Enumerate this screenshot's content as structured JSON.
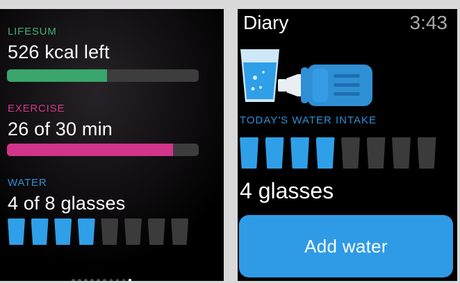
{
  "colors": {
    "lifesum_green": "#3aa56c",
    "exercise_pink": "#d2348a",
    "water_blue": "#2f9fe8",
    "track_gray": "#3d3d3d",
    "button_blue": "#2f9be6"
  },
  "summary": {
    "lifesum": {
      "label": "LIFESUM",
      "value": "526 kcal left",
      "progress": 0.52
    },
    "exercise": {
      "label": "EXERCISE",
      "value": "26 of 30 min",
      "progress": 0.867
    },
    "water": {
      "label": "WATER",
      "value": "4 of 8 glasses",
      "filled": 4,
      "total": 8
    },
    "pager": {
      "count": 10,
      "active": 9
    }
  },
  "diary": {
    "title": "Diary",
    "time": "3:43",
    "icons": [
      "water-glass-icon",
      "water-bottle-icon"
    ],
    "intake_label": "TODAY'S WATER INTAKE",
    "filled": 4,
    "total": 8,
    "count_text": "4 glasses",
    "add_button": "Add water"
  }
}
